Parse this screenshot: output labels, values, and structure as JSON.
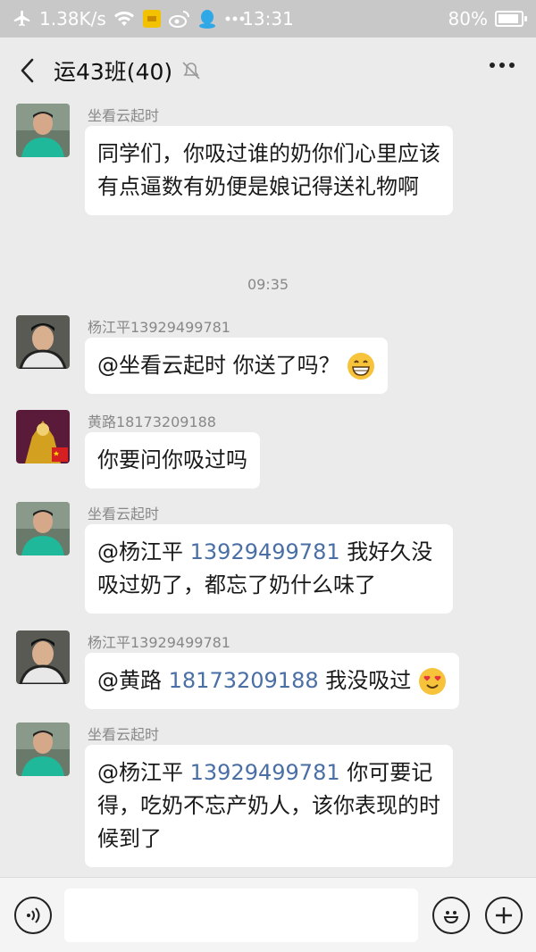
{
  "status_bar": {
    "speed": "1.38K/s",
    "time": "13:31",
    "battery": "80%",
    "battery_level": 0.8,
    "icons": [
      "airplane-icon",
      "wifi-icon",
      "app-notification-icon",
      "weibo-icon",
      "qq-icon",
      "more-notifications-icon"
    ]
  },
  "header": {
    "title": "运43班(40)",
    "back_icon": "chevron-left-icon",
    "mute_icon": "bell-muted-icon",
    "more_icon": "more-dots-icon"
  },
  "messages": [
    {
      "sender": "坐看云起时",
      "avatar": "avatar-green-shirt",
      "parts": [
        {
          "text": "同学们，你吸过谁的奶你们心里应该有点逼数有奶便是娘记得送礼物啊",
          "link": false
        }
      ]
    },
    {
      "sender": "杨江平13929499781",
      "avatar": "avatar-dark-hair",
      "parts": [
        {
          "text": "@坐看云起时  你送了吗？",
          "link": false
        }
      ],
      "emoji": "grinning-face"
    },
    {
      "sender": "黄路18173209188",
      "avatar": "avatar-golden-armor",
      "parts": [
        {
          "text": "你要问你吸过吗",
          "link": false
        }
      ]
    },
    {
      "sender": "坐看云起时",
      "avatar": "avatar-green-shirt",
      "parts": [
        {
          "text": "@杨江平 ",
          "link": false
        },
        {
          "text": "13929499781",
          "link": true
        },
        {
          "text": " 我好久没吸过奶了，都忘了奶什么味了",
          "link": false
        }
      ]
    },
    {
      "sender": "杨江平13929499781",
      "avatar": "avatar-dark-hair",
      "parts": [
        {
          "text": "@黄路 ",
          "link": false
        },
        {
          "text": "18173209188",
          "link": true
        },
        {
          "text": " 我没吸过",
          "link": false
        }
      ],
      "emoji": "heart-eyes-face"
    },
    {
      "sender": "坐看云起时",
      "avatar": "avatar-green-shirt",
      "parts": [
        {
          "text": "@杨江平 ",
          "link": false
        },
        {
          "text": "13929499781",
          "link": true
        },
        {
          "text": " 你可要记得，吃奶不忘产奶人，该你表现的时候到了",
          "link": false
        }
      ]
    }
  ],
  "timestamp": "09:35",
  "input_bar": {
    "voice_icon": "voice-icon",
    "emoji_icon": "emoji-icon",
    "plus_icon": "plus-icon",
    "placeholder": ""
  },
  "colors": {
    "status_bar_bg": "#c8c8c8",
    "chat_bg": "#ebebeb",
    "bubble_bg": "#ffffff",
    "link": "#4a6fa5",
    "sender_name": "#888888"
  }
}
